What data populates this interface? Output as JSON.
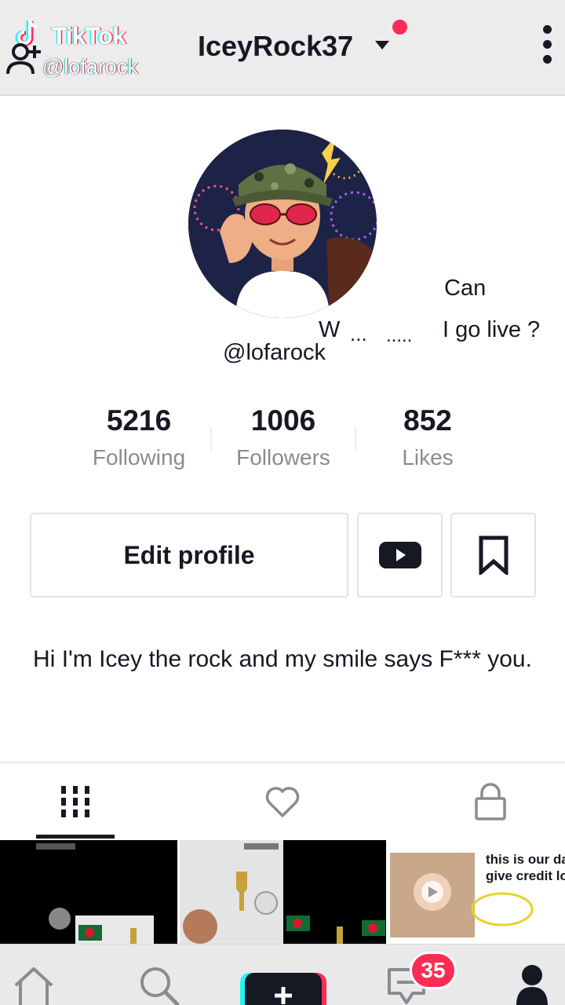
{
  "watermark": {
    "brand": "TikTok",
    "handle": "@lofarock"
  },
  "header": {
    "username": "IceyRock37"
  },
  "overlay": {
    "can": "Can",
    "w": "W",
    "dots_1": "...",
    "dots_2": ".....",
    "go_live": "I go live ?"
  },
  "profile": {
    "handle": "@lofarock",
    "bio": "Hi I'm Icey the rock and my smile says F*** you."
  },
  "stats": [
    {
      "value": "5216",
      "label": "Following"
    },
    {
      "value": "1006",
      "label": "Followers"
    },
    {
      "value": "852",
      "label": "Likes"
    }
  ],
  "buttons": {
    "edit_profile": "Edit profile"
  },
  "videos": {
    "third_caption_line1": "this is our da",
    "third_caption_line2": "give credit lo"
  },
  "nav": {
    "inbox_badge": "35"
  },
  "colors": {
    "accent": "#fe2c55",
    "cyan": "#25f4ee",
    "text": "#161823",
    "muted": "#8a8b91"
  }
}
